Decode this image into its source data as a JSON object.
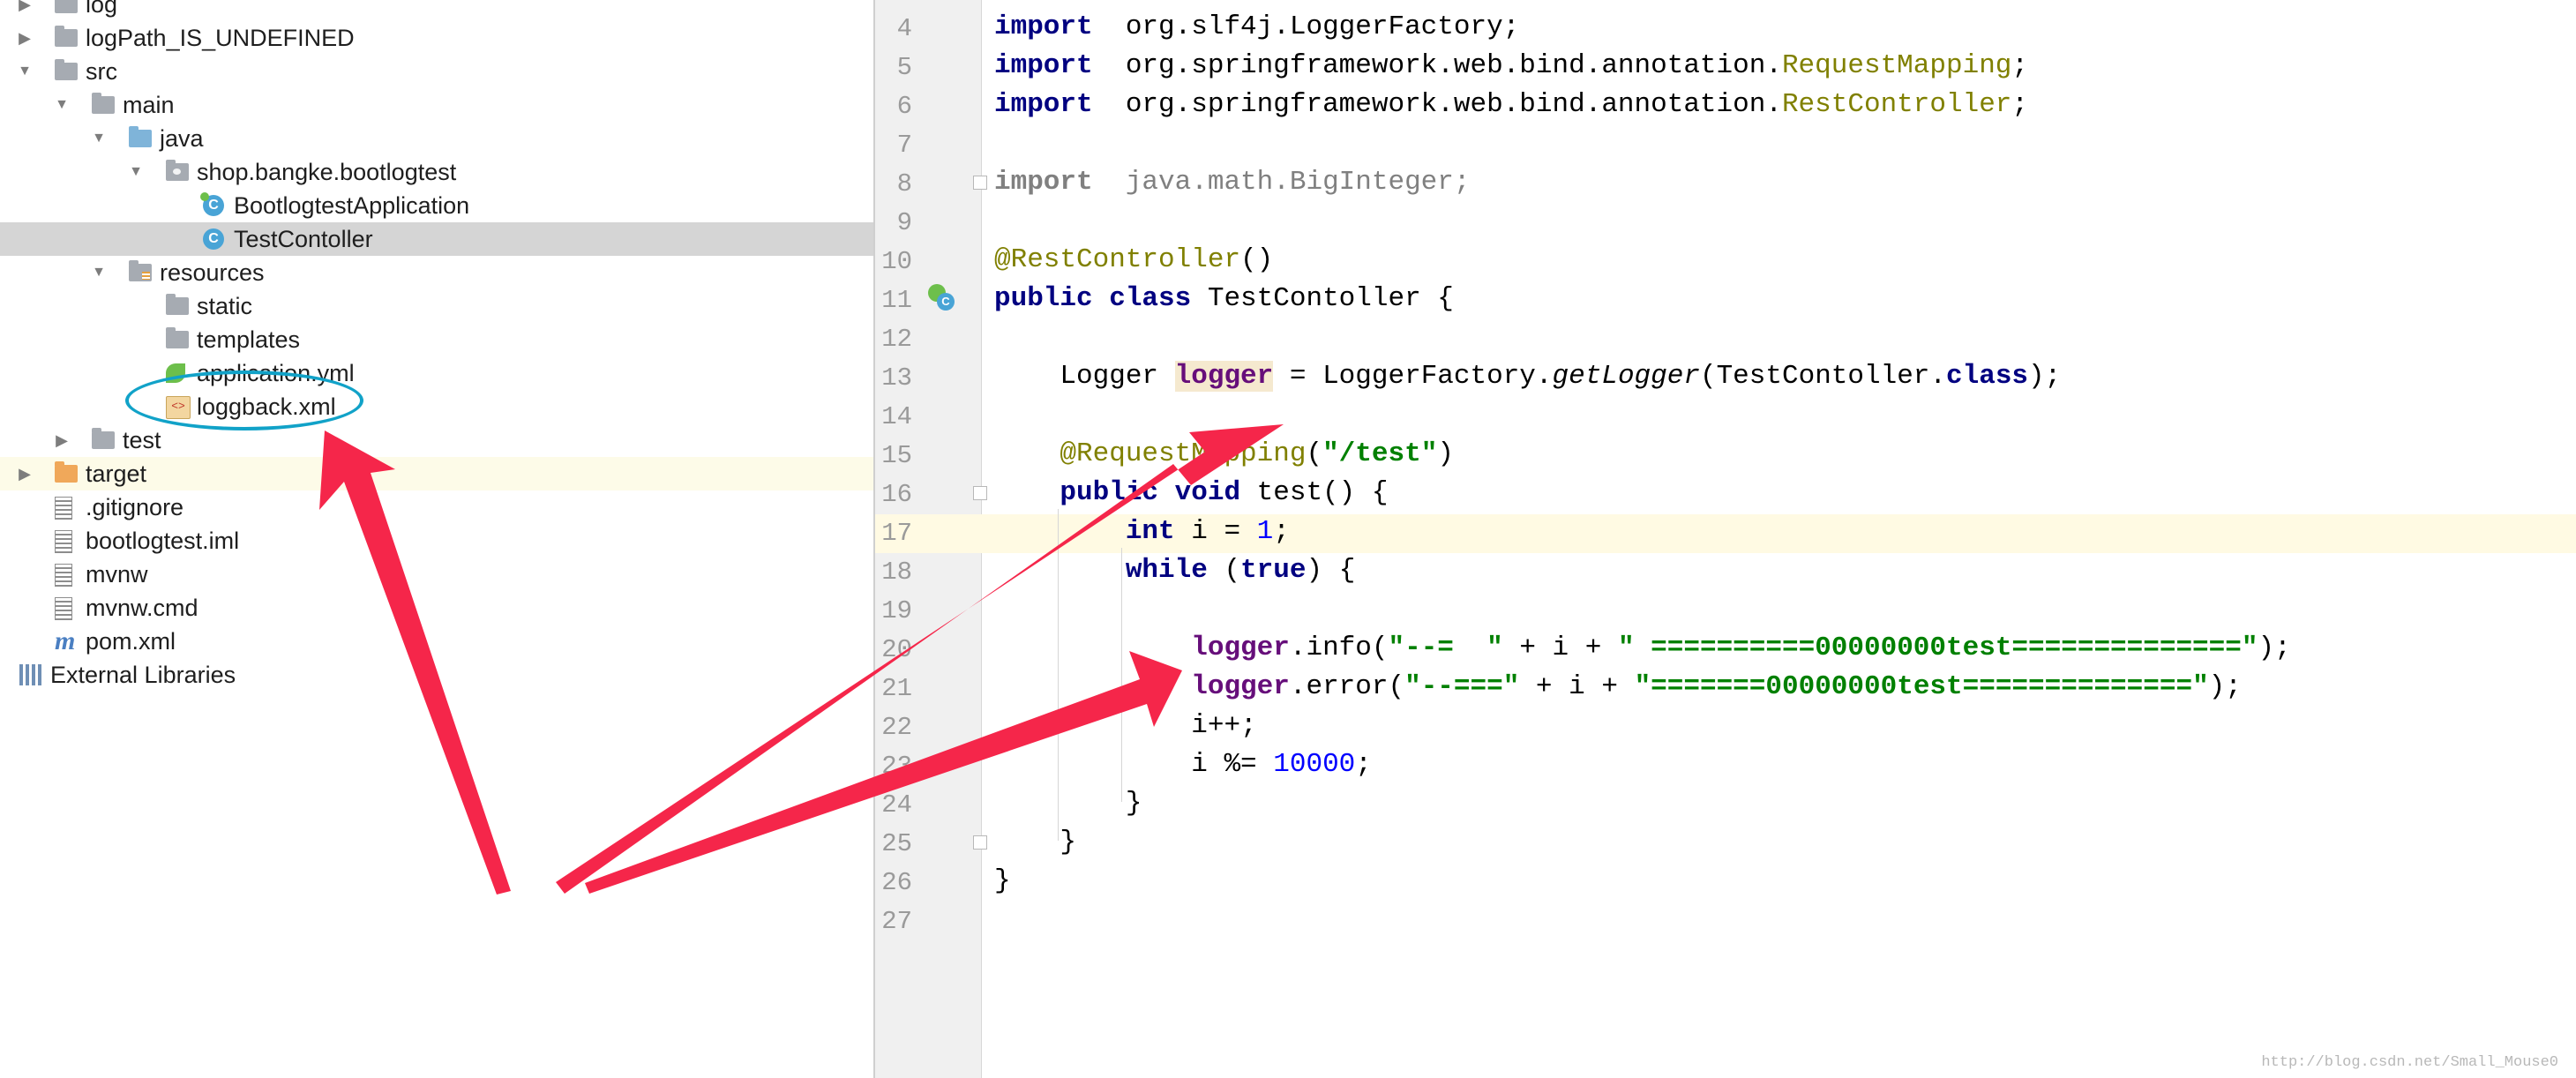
{
  "tree": [
    {
      "label": "log",
      "indent": 0,
      "arrow": "right",
      "icon": "folder"
    },
    {
      "label": "logPath_IS_UNDEFINED",
      "indent": 0,
      "arrow": "right",
      "icon": "folder"
    },
    {
      "label": "src",
      "indent": 0,
      "arrow": "down",
      "icon": "folder"
    },
    {
      "label": "main",
      "indent": 1,
      "arrow": "down",
      "icon": "folder"
    },
    {
      "label": "java",
      "indent": 2,
      "arrow": "down",
      "icon": "folder-source"
    },
    {
      "label": "shop.bangke.bootlogtest",
      "indent": 3,
      "arrow": "down",
      "icon": "package"
    },
    {
      "label": "BootlogtestApplication",
      "indent": 4,
      "arrow": "",
      "icon": "spring-boot-class"
    },
    {
      "label": "TestContoller",
      "indent": 4,
      "arrow": "",
      "icon": "class",
      "selected": true
    },
    {
      "label": "resources",
      "indent": 2,
      "arrow": "down",
      "icon": "folder-resources"
    },
    {
      "label": "static",
      "indent": 3,
      "arrow": "",
      "icon": "folder"
    },
    {
      "label": "templates",
      "indent": 3,
      "arrow": "",
      "icon": "folder"
    },
    {
      "label": "application.yml",
      "indent": 3,
      "arrow": "",
      "icon": "spring-config"
    },
    {
      "label": "loggback.xml",
      "indent": 3,
      "arrow": "",
      "icon": "xml-file",
      "circled": true
    },
    {
      "label": "test",
      "indent": 1,
      "arrow": "right",
      "icon": "folder"
    },
    {
      "label": "target",
      "indent": 0,
      "arrow": "right",
      "icon": "folder-excluded",
      "highlight": true
    },
    {
      "label": ".gitignore",
      "indent": 0,
      "arrow": "",
      "icon": "text-file"
    },
    {
      "label": "bootlogtest.iml",
      "indent": 0,
      "arrow": "",
      "icon": "text-file"
    },
    {
      "label": "mvnw",
      "indent": 0,
      "arrow": "",
      "icon": "text-file"
    },
    {
      "label": "mvnw.cmd",
      "indent": 0,
      "arrow": "",
      "icon": "text-file"
    },
    {
      "label": "pom.xml",
      "indent": 0,
      "arrow": "",
      "icon": "maven"
    },
    {
      "label": "External Libraries",
      "indent": -1,
      "arrow": "",
      "icon": "libraries"
    }
  ],
  "editor": {
    "caret_line": 17,
    "lines": [
      {
        "n": "4",
        "tokens": [
          [
            "kw",
            "import"
          ],
          [
            "",
            "  org.slf4j.LoggerFactory;"
          ]
        ]
      },
      {
        "n": "5",
        "tokens": [
          [
            "kw",
            "import"
          ],
          [
            "",
            "  org.springframework.web.bind.annotation."
          ],
          [
            "ann",
            "RequestMapping"
          ],
          [
            "",
            ";"
          ]
        ]
      },
      {
        "n": "6",
        "tokens": [
          [
            "kw",
            "import"
          ],
          [
            "",
            "  org.springframework.web.bind.annotation."
          ],
          [
            "ann",
            "RestController"
          ],
          [
            "",
            ";"
          ]
        ]
      },
      {
        "n": "7",
        "tokens": []
      },
      {
        "n": "8",
        "tokens": [
          [
            "gray kw",
            "import"
          ],
          [
            "gray",
            "  java.math.BigInteger;"
          ]
        ]
      },
      {
        "n": "9",
        "tokens": []
      },
      {
        "n": "10",
        "tokens": [
          [
            "ann",
            "@RestController"
          ],
          [
            "",
            "()"
          ]
        ]
      },
      {
        "n": "11",
        "tokens": [
          [
            "kw",
            "public class"
          ],
          [
            "",
            " TestContoller {"
          ]
        ]
      },
      {
        "n": "12",
        "tokens": []
      },
      {
        "n": "13",
        "tokens": [
          [
            "",
            "    Logger "
          ],
          [
            "fld hlvar",
            "logger"
          ],
          [
            "",
            " = LoggerFactory."
          ],
          [
            "ital",
            "getLogger"
          ],
          [
            "",
            "(TestContoller."
          ],
          [
            "kw",
            "class"
          ],
          [
            "",
            ");"
          ]
        ]
      },
      {
        "n": "14",
        "tokens": []
      },
      {
        "n": "15",
        "tokens": [
          [
            "ann",
            "    @RequestMapping"
          ],
          [
            "",
            "("
          ],
          [
            "str",
            "\"/test\""
          ],
          [
            "",
            ")"
          ]
        ]
      },
      {
        "n": "16",
        "tokens": [
          [
            "kw",
            "    public void"
          ],
          [
            "",
            " test() {"
          ]
        ]
      },
      {
        "n": "17",
        "tokens": [
          [
            "kw",
            "        int"
          ],
          [
            "",
            " i = "
          ],
          [
            "num",
            "1"
          ],
          [
            "",
            ";"
          ]
        ]
      },
      {
        "n": "18",
        "tokens": [
          [
            "kw",
            "        while"
          ],
          [
            "",
            " ("
          ],
          [
            "kw",
            "true"
          ],
          [
            "",
            ") {"
          ]
        ]
      },
      {
        "n": "19",
        "tokens": []
      },
      {
        "n": "20",
        "tokens": [
          [
            "fld",
            "            logger"
          ],
          [
            "",
            ".info("
          ],
          [
            "str",
            "\"--=  \""
          ],
          [
            "",
            " + i + "
          ],
          [
            "str",
            "\" ==========00000000test==============\""
          ],
          [
            "",
            ");"
          ]
        ]
      },
      {
        "n": "21",
        "tokens": [
          [
            "fld",
            "            logger"
          ],
          [
            "",
            ".error("
          ],
          [
            "str",
            "\"--===\""
          ],
          [
            "",
            " + i + "
          ],
          [
            "str",
            "\"=======00000000test==============\""
          ],
          [
            "",
            ");"
          ]
        ]
      },
      {
        "n": "22",
        "tokens": [
          [
            "",
            "            i++;"
          ]
        ]
      },
      {
        "n": "23",
        "tokens": [
          [
            "",
            "            i %= "
          ],
          [
            "num",
            "10000"
          ],
          [
            "",
            ";"
          ]
        ]
      },
      {
        "n": "24",
        "tokens": [
          [
            "",
            "        }"
          ]
        ]
      },
      {
        "n": "25",
        "tokens": [
          [
            "",
            "    }"
          ]
        ]
      },
      {
        "n": "26",
        "tokens": [
          [
            "",
            "}"
          ]
        ]
      },
      {
        "n": "27",
        "tokens": []
      }
    ]
  },
  "icons": {
    "class_letter": "C",
    "xml_glyph": "<>",
    "maven_glyph": "m"
  },
  "colors": {
    "keyword": "#000080",
    "annotation": "#808000",
    "string": "#008000",
    "number": "#0000ff",
    "field": "#660e7a",
    "selection": "#d5d5d5",
    "caret_line": "#fffae3",
    "annotation_arrow": "#f5264a",
    "circle": "#11a2c8"
  },
  "watermark": "http://blog.csdn.net/Small_Mouse0"
}
